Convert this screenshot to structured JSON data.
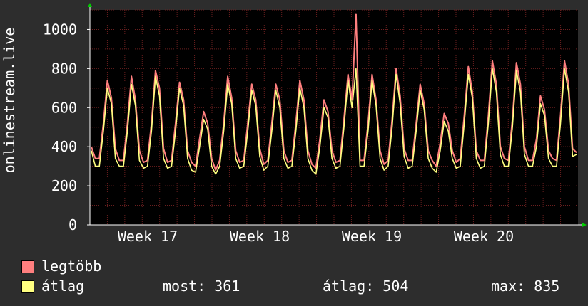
{
  "chart_data": {
    "type": "line",
    "ylabel": "onlinestream.live",
    "ylim": [
      0,
      1100
    ],
    "yticks": [
      0,
      200,
      400,
      600,
      800,
      1000
    ],
    "xticks": [
      "Week 17",
      "Week 18",
      "Week 19",
      "Week 20"
    ],
    "grid": true,
    "series": [
      {
        "name": "legtöbb",
        "color": "#ff7f7f",
        "values": [
          400,
          340,
          340,
          520,
          740,
          650,
          390,
          330,
          330,
          520,
          760,
          640,
          380,
          320,
          330,
          520,
          790,
          700,
          390,
          320,
          330,
          520,
          730,
          640,
          380,
          320,
          300,
          440,
          580,
          520,
          340,
          280,
          330,
          520,
          760,
          650,
          380,
          320,
          330,
          520,
          720,
          640,
          390,
          310,
          330,
          520,
          720,
          640,
          380,
          320,
          330,
          520,
          740,
          640,
          380,
          310,
          290,
          440,
          640,
          580,
          380,
          320,
          330,
          540,
          770,
          640,
          1080,
          330,
          330,
          520,
          770,
          640,
          380,
          310,
          330,
          540,
          800,
          660,
          390,
          330,
          330,
          520,
          720,
          620,
          380,
          330,
          300,
          420,
          570,
          520,
          380,
          320,
          340,
          560,
          810,
          680,
          380,
          330,
          330,
          560,
          840,
          720,
          400,
          340,
          330,
          540,
          830,
          720,
          400,
          330,
          330,
          440,
          660,
          590,
          380,
          340,
          330,
          560,
          840,
          720,
          390,
          370
        ]
      },
      {
        "name": "átlag",
        "color": "#ffff80",
        "values": [
          380,
          300,
          300,
          480,
          700,
          620,
          340,
          300,
          300,
          480,
          720,
          610,
          330,
          290,
          300,
          480,
          760,
          660,
          340,
          290,
          300,
          480,
          700,
          610,
          340,
          280,
          270,
          400,
          540,
          490,
          300,
          260,
          300,
          480,
          720,
          620,
          340,
          290,
          300,
          480,
          690,
          610,
          350,
          280,
          300,
          480,
          690,
          600,
          340,
          290,
          300,
          480,
          700,
          600,
          340,
          280,
          260,
          400,
          600,
          550,
          340,
          290,
          300,
          500,
          740,
          600,
          800,
          300,
          300,
          480,
          740,
          610,
          340,
          280,
          300,
          500,
          770,
          620,
          350,
          290,
          300,
          480,
          690,
          590,
          340,
          290,
          270,
          380,
          530,
          480,
          340,
          290,
          300,
          520,
          770,
          650,
          340,
          290,
          300,
          520,
          800,
          680,
          360,
          300,
          300,
          500,
          790,
          680,
          360,
          300,
          300,
          400,
          620,
          560,
          340,
          300,
          300,
          520,
          800,
          680,
          350,
          361
        ]
      }
    ]
  },
  "legend": {
    "max_label": "legtöbb",
    "avg_label": "átlag",
    "max_color": "#ff7f7f",
    "avg_color": "#ffff80",
    "now_stat": "most: 361",
    "avg_stat": "átlag: 504",
    "max_stat": "max: 835"
  },
  "colors": {
    "background": "#2d2d2d",
    "plot_background": "#000000",
    "grid": "#6b1f1f",
    "axis": "#ffffff",
    "arrow": "#00cc00"
  }
}
